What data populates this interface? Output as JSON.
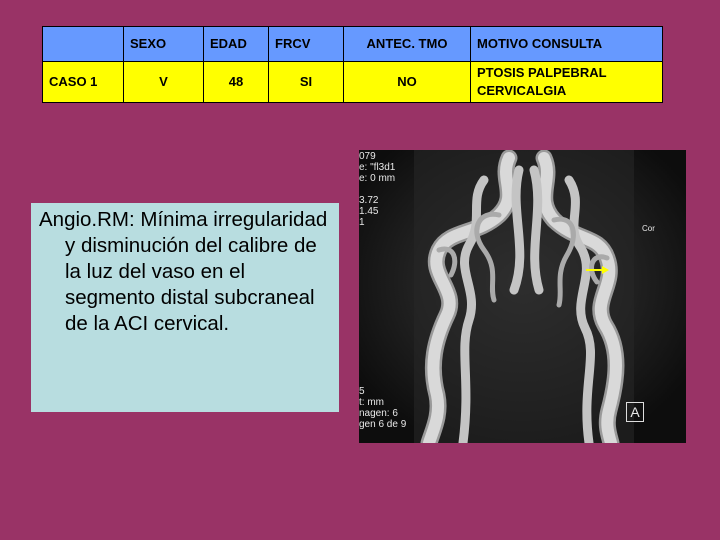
{
  "table": {
    "headers": [
      "",
      "SEXO",
      "EDAD",
      "FRCV",
      "ANTEC. TMO",
      "MOTIVO CONSULTA"
    ],
    "row": {
      "case": "CASO 1",
      "sexo": "V",
      "edad": "48",
      "frcv": "SI",
      "antec": "NO",
      "motivo_line1": "PTOSIS PALPEBRAL",
      "motivo_line2": "CERVICALGIA"
    }
  },
  "caption": "Angio.RM: Mínima irregularidad y disminución del calibre de la luz del vaso en el segmento distal subcraneal de la ACI cervical.",
  "image_overlay": {
    "lines": [
      "079",
      "e: \"fl3d1",
      "e: 0 mm",
      "",
      "3.72",
      "1.45",
      "1"
    ],
    "bottom_lines": [
      "5",
      "t: mm",
      "nagen: 6",
      "gen 6 de 9"
    ],
    "side_label": "Cor",
    "corner_label": "A"
  },
  "colors": {
    "background": "#993366",
    "table_header": "#6699ff",
    "table_body": "#ffff00",
    "caption_box": "#b8dde0",
    "arrow": "#ffff00"
  }
}
